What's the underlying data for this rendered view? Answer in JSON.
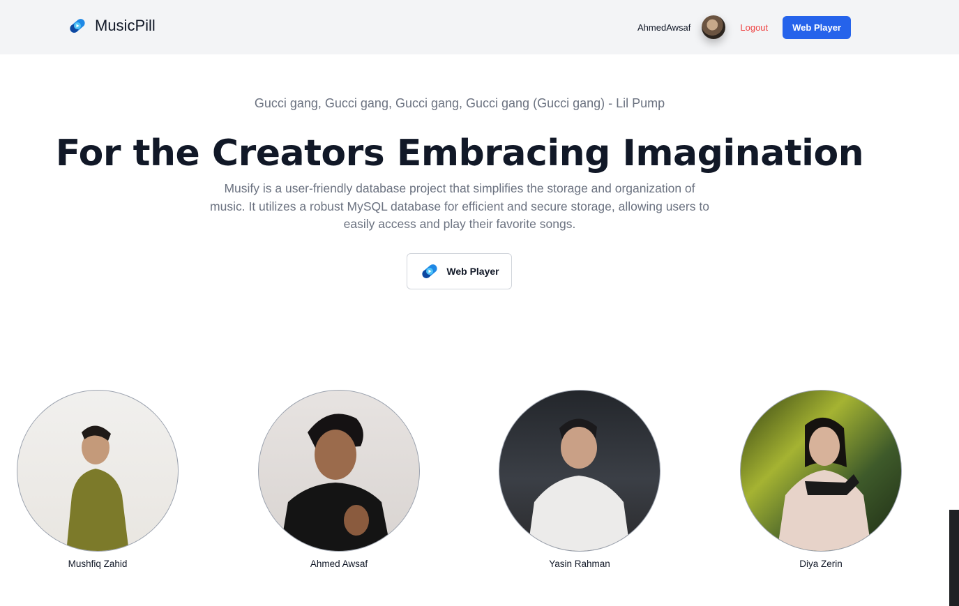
{
  "header": {
    "brand": "MusicPill",
    "username": "AhmedAwsaf",
    "logout_label": "Logout",
    "web_player_label": "Web Player"
  },
  "hero": {
    "quote": "Gucci gang, Gucci gang, Gucci gang, Gucci gang (Gucci gang) - Lil Pump",
    "headline": "For the Creators Embracing Imagination",
    "description": "Musify is a user-friendly database project that simplifies the storage and organization of music. It utilizes a robust MySQL database for efficient and secure storage, allowing users to easily access and play their favorite songs.",
    "button_label": "Web Player"
  },
  "team": [
    {
      "name": "Mushfiq Zahid"
    },
    {
      "name": "Ahmed Awsaf"
    },
    {
      "name": "Yasin Rahman"
    },
    {
      "name": "Diya Zerin"
    }
  ],
  "colors": {
    "accent": "#2563eb",
    "logout": "#ef4444",
    "header_bg": "#f3f4f6",
    "heading": "#111827",
    "muted_text": "#6b7280"
  },
  "icons": {
    "brand_logo": "musicpill-logo-icon",
    "user_avatar": "avatar"
  }
}
